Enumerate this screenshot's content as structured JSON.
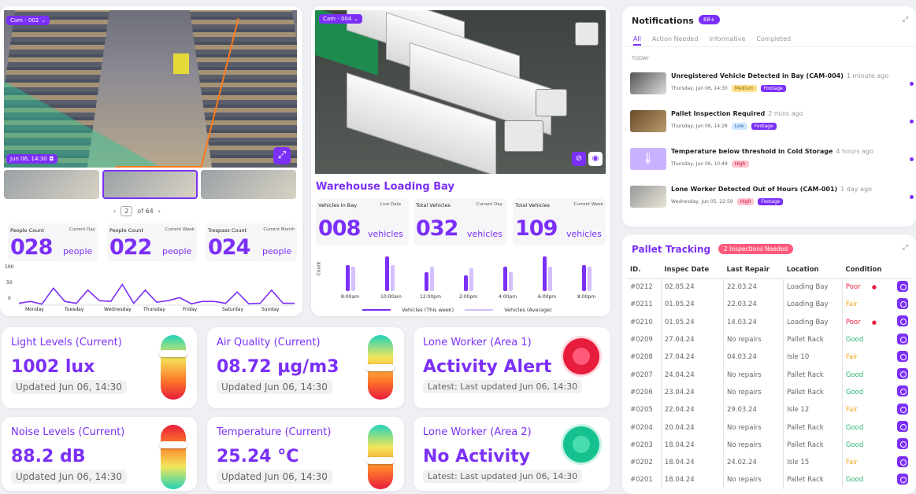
{
  "colors": {
    "accent": "#7b2ff7",
    "poor": "#e81c3c",
    "fair": "#f5a623",
    "good": "#2bb673",
    "alert": "#e81c3c",
    "ok": "#22c9a0"
  },
  "cam1": {
    "tag": "Cam - 002",
    "timestamp": "Jun 06, 14:30",
    "pager": {
      "current": "2",
      "total_label": "of 64"
    }
  },
  "people": [
    {
      "label": "People Count",
      "period": "Current Day",
      "value": "028",
      "unit": "people"
    },
    {
      "label": "People Count",
      "period": "Current Week",
      "value": "022",
      "unit": "people"
    },
    {
      "label": "Trespass Count",
      "period": "Current Month",
      "value": "024",
      "unit": "people"
    }
  ],
  "people_chart": {
    "yticks": [
      "100",
      "50",
      "0"
    ],
    "days": [
      "Monday",
      "Tuesday",
      "Wednesday",
      "Thursday",
      "Friday",
      "Saturday",
      "Sunday"
    ],
    "values": [
      5,
      10,
      3,
      45,
      10,
      5,
      40,
      12,
      10,
      55,
      5,
      40,
      8,
      12,
      20,
      4,
      10,
      10,
      5,
      35,
      4,
      5,
      40,
      5,
      5
    ]
  },
  "cam2": {
    "tag": "Cam - 004",
    "title": "Warehouse Loading Bay"
  },
  "vehicles": [
    {
      "label": "Vehicles In Bay",
      "period": "Live Data",
      "value": "008",
      "unit": "vehicles"
    },
    {
      "label": "Total Vehicles",
      "period": "Current Day",
      "value": "032",
      "unit": "vehicles"
    },
    {
      "label": "Total Vehicles",
      "period": "Current Week",
      "value": "109",
      "unit": "vehicles"
    }
  ],
  "chart_data": {
    "type": "bar",
    "ylabel": "Count",
    "categories": [
      "8:00am",
      "10:00am",
      "12:00pm",
      "2:00pm",
      "4:00pm",
      "6:00pm",
      "8:00pm"
    ],
    "series": [
      {
        "name": "Vehicles (This week)",
        "values": [
          30,
          40,
          22,
          18,
          28,
          40,
          30
        ]
      },
      {
        "name": "Vehicles (Average)",
        "values": [
          28,
          30,
          28,
          26,
          22,
          28,
          28
        ]
      }
    ]
  },
  "tiles": [
    {
      "title": "Light Levels (Current)",
      "value": "1002 lux",
      "updated": "Updated Jun 06, 14:30",
      "level": 0.28,
      "reverse": false
    },
    {
      "title": "Air Quality (Current)",
      "value": "08.72 µg/m3",
      "updated": "Updated Jun 06, 14:30",
      "level": 0.5,
      "reverse": false
    },
    {
      "title": "Noise Levels (Current)",
      "value": "88.2 dB",
      "updated": "Updated Jun 06, 14:30",
      "level": 0.3,
      "reverse": true
    },
    {
      "title": "Temperature (Current)",
      "value": "25.24 °C",
      "updated": "Updated Jun 06, 14:30",
      "level": 0.55,
      "reverse": false
    }
  ],
  "lone": [
    {
      "title": "Lone Worker (Area 1)",
      "status": "Activity Alert",
      "latest": "Latest: Last updated Jun 06, 14:30",
      "state": "alert"
    },
    {
      "title": "Lone Worker (Area 2)",
      "status": "No Activity",
      "latest": "Latest: Last updated Jun 06, 14:30",
      "state": "ok"
    }
  ],
  "notifications": {
    "title": "Notifications",
    "count": "68+",
    "tabs": [
      "All",
      "Action Needed",
      "Informative",
      "Completed"
    ],
    "section": "TODAY",
    "items": [
      {
        "title": "Unregistered Vehicle Detected in Bay (CAM-004)",
        "time": "1 minute ago",
        "date": "Thursday, Jun 06, 14:30",
        "priority": "Medium",
        "footage": "Footage"
      },
      {
        "title": "Pallet Inspection Required",
        "time": "2 mins ago",
        "date": "Thursday, Jun 06, 14:28",
        "priority": "Low",
        "footage": "Footage"
      },
      {
        "title": "Temperature below threshold in Cold Storage",
        "time": "4 hours ago",
        "date": "Thursday, Jun 06, 10:49",
        "priority": "High",
        "footage": ""
      },
      {
        "title": "Lone Worker Detected Out of Hours (CAM-001)",
        "time": "1 day ago",
        "date": "Wednesday, Jun 05, 22:59",
        "priority": "High",
        "footage": "Footage"
      }
    ]
  },
  "pallet": {
    "title": "Pallet Tracking",
    "badge": "2 Inspections Needed",
    "columns": [
      "ID.",
      "Inspec Date",
      "Last Repair",
      "Location",
      "Condition"
    ],
    "rows": [
      [
        "#0212",
        "02.05.24",
        "22.03.24",
        "Loading Bay",
        "Poor"
      ],
      [
        "#0211",
        "01.05.24",
        "22.03.24",
        "Loading Bay",
        "Fair"
      ],
      [
        "#0210",
        "01.05.24",
        "14.03.24",
        "Loading Bay",
        "Poor"
      ],
      [
        "#0209",
        "27.04.24",
        "No repairs",
        "Pallet Rack",
        "Good"
      ],
      [
        "#0208",
        "27.04.24",
        "04.03.24",
        "Isle 10",
        "Fair"
      ],
      [
        "#0207",
        "24.04.24",
        "No repairs",
        "Pallet Rack",
        "Good"
      ],
      [
        "#0206",
        "23.04.24",
        "No repairs",
        "Pallet Rack",
        "Good"
      ],
      [
        "#0205",
        "22.04.24",
        "29.03.24",
        "Isle 12",
        "Fair"
      ],
      [
        "#0204",
        "20.04.24",
        "No repairs",
        "Pallet Rack",
        "Good"
      ],
      [
        "#0203",
        "18.04.24",
        "No repairs",
        "Pallet Rack",
        "Good"
      ],
      [
        "#0202",
        "18.04.24",
        "24.02.24",
        "Isle 15",
        "Fair"
      ],
      [
        "#0201",
        "18.04.24",
        "No repairs",
        "Pallet Rack",
        "Good"
      ]
    ]
  }
}
